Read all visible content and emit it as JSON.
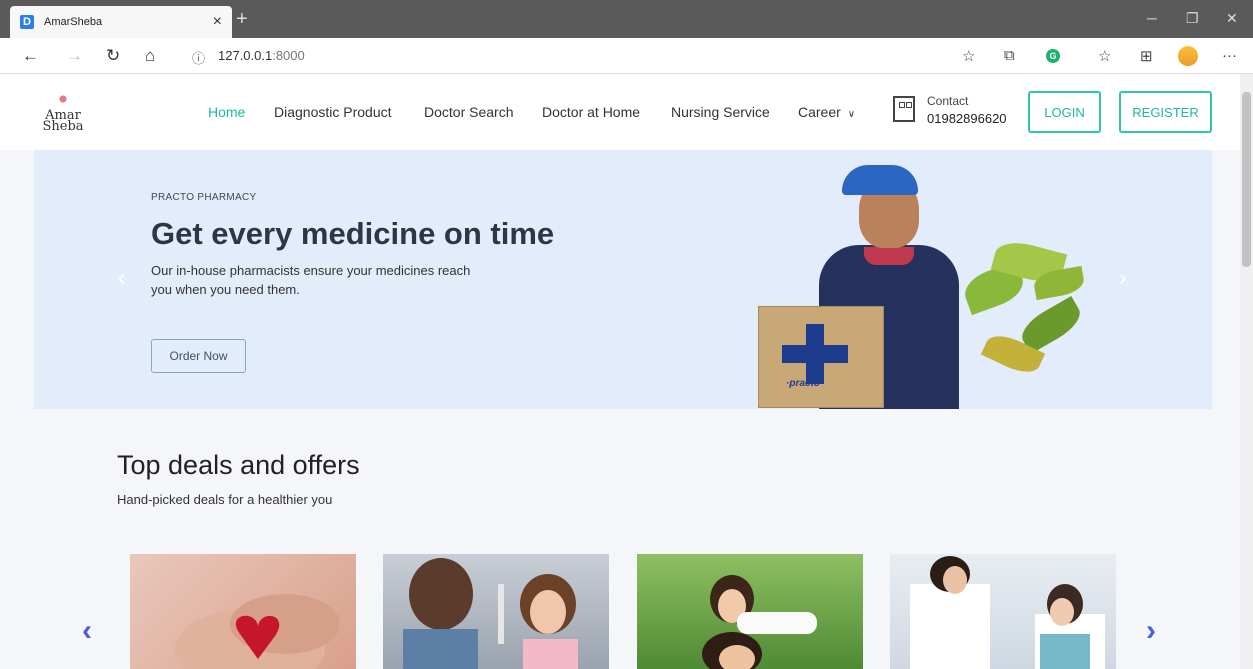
{
  "browser": {
    "tab_title": "AmarSheba",
    "tab_favicon": "D",
    "url_host": "127.0.0.1",
    "url_port": ":8000"
  },
  "site": {
    "logo_line1": "Amar",
    "logo_line2": "Sheba",
    "nav": [
      "Home",
      "Diagnostic Product",
      "Doctor Search",
      "Doctor at Home",
      "Nursing Service",
      "Career"
    ],
    "contact_label": "Contact",
    "contact_phone": "01982896620",
    "login_label": "LOGIN",
    "register_label": "REGISTER"
  },
  "hero": {
    "kicker": "PRACTO PHARMACY",
    "title": "Get every medicine on time",
    "subtitle": "Our in-house pharmacists ensure your medicines reach you when you need them.",
    "button": "Order Now",
    "box_brand": "·practo·"
  },
  "deals": {
    "title": "Top deals and offers",
    "subtitle": "Hand-picked deals for a healthier you"
  },
  "icons": {
    "back": "arrow-left-icon",
    "forward": "arrow-right-icon",
    "refresh": "refresh-icon",
    "home": "home-icon",
    "info": "info-icon",
    "star": "star-icon",
    "career_caret": "chevron-down-icon",
    "carousel_prev": "chevron-left-icon",
    "carousel_next": "chevron-right-icon"
  },
  "colors": {
    "accent": "#1fb99d",
    "hero_bg": "#e3ecfa",
    "carousel_arrow": "#4b5fd6"
  }
}
